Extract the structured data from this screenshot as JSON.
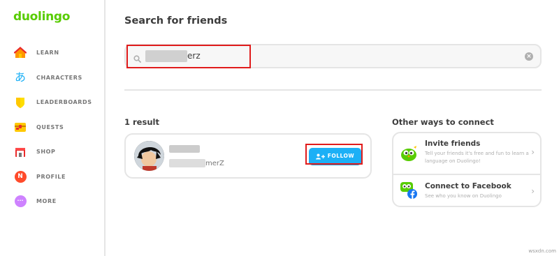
{
  "brand": {
    "logo": "duolingo"
  },
  "sidebar": {
    "items": [
      {
        "label": "LEARN",
        "icon": "home-icon"
      },
      {
        "label": "CHARACTERS",
        "icon": "hiragana-icon",
        "glyph": "あ"
      },
      {
        "label": "LEADERBOARDS",
        "icon": "shield-icon"
      },
      {
        "label": "QUESTS",
        "icon": "treasure-chest-icon"
      },
      {
        "label": "SHOP",
        "icon": "shop-icon"
      },
      {
        "label": "PROFILE",
        "icon": "profile-avatar-icon",
        "glyph": "N"
      },
      {
        "label": "MORE",
        "icon": "more-icon",
        "glyph": "···"
      }
    ]
  },
  "main": {
    "title": "Search for friends",
    "search": {
      "value": "erz",
      "icon": "search-icon",
      "clear_icon": "clear-icon"
    }
  },
  "results": {
    "count_label": "1 result",
    "items": [
      {
        "username": "merZ",
        "follow_label": "FOLLOW"
      }
    ]
  },
  "connect": {
    "title": "Other ways to connect",
    "items": [
      {
        "title": "Invite friends",
        "desc": "Tell your friends it's free and fun to learn a language on Duolingo!",
        "icon": "duo-owl-icon"
      },
      {
        "title": "Connect to Facebook",
        "desc": "See who you know on Duolingo",
        "icon": "facebook-icon"
      }
    ]
  },
  "watermark": "wsxdn.com",
  "colors": {
    "brand_green": "#58cc02",
    "follow_blue": "#1cb0f6",
    "highlight_red": "#e01b1b",
    "text_dark": "#3c3c3c",
    "text_gray": "#777777"
  }
}
